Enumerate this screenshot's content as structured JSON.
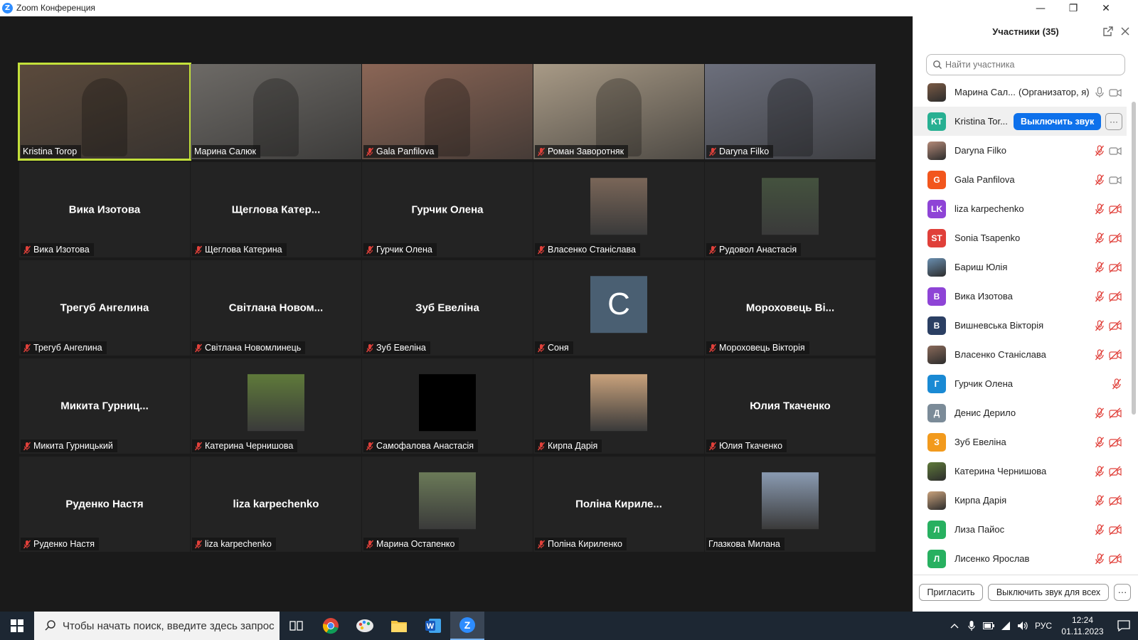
{
  "window": {
    "title": "Zoom Конференция",
    "minimize_glyph": "—",
    "restore_glyph": "❐",
    "close_glyph": "✕"
  },
  "tiles": [
    {
      "name": "Kristina Torop",
      "kind": "video",
      "muted": false,
      "active": true,
      "bg": "#5b4a3c"
    },
    {
      "name": "Марина Салюк",
      "kind": "video",
      "muted": false,
      "bg": "#6d6a66"
    },
    {
      "name": "Gala Panfilova",
      "kind": "video",
      "muted": true,
      "bg": "#8b6656"
    },
    {
      "name": "Роман Заворотняк",
      "kind": "video",
      "muted": true,
      "bg": "#a89a86"
    },
    {
      "name": "Daryna Filko",
      "kind": "video",
      "muted": true,
      "bg": "#6c6f7c"
    },
    {
      "name": "Вика Изотова",
      "kind": "name",
      "center": "Вика Изотова",
      "muted": true
    },
    {
      "name": "Щеглова Катерина",
      "kind": "name",
      "center": "Щеглова Катер...",
      "muted": true
    },
    {
      "name": "Гурчик Олена",
      "kind": "name",
      "center": "Гурчик Олена",
      "muted": true
    },
    {
      "name": "Власенко Станіслава",
      "kind": "photo",
      "muted": true,
      "bg": "#7a6658"
    },
    {
      "name": "Рудовол Анастасія",
      "kind": "photo",
      "muted": true,
      "bg": "#44523e"
    },
    {
      "name": "Трегуб Ангелина",
      "kind": "name",
      "center": "Трегуб Ангелина",
      "muted": true
    },
    {
      "name": "Світлана Новомлинець",
      "kind": "name",
      "center": "Світлана Новом...",
      "muted": true
    },
    {
      "name": "Зуб Евеліна",
      "kind": "name",
      "center": "Зуб Евеліна",
      "muted": true
    },
    {
      "name": "Соня",
      "kind": "letter",
      "letter": "C",
      "muted": true
    },
    {
      "name": "Мороховець Вікторія",
      "kind": "name",
      "center": "Мороховець Ві...",
      "muted": true
    },
    {
      "name": "Микита Гурницький",
      "kind": "name",
      "center": "Микита Гурниц...",
      "muted": true
    },
    {
      "name": "Катерина Чернишова",
      "kind": "photo",
      "muted": true,
      "bg": "#5f7a3a"
    },
    {
      "name": "Самофалова Анастасія",
      "kind": "photo",
      "muted": true,
      "bg": "#000000"
    },
    {
      "name": "Кирпа Дарія",
      "kind": "photo",
      "muted": true,
      "bg": "#c9a27c"
    },
    {
      "name": "Юлия Ткаченко",
      "kind": "name",
      "center": "Юлия Ткаченко",
      "muted": true
    },
    {
      "name": "Руденко Настя",
      "kind": "name",
      "center": "Руденко Настя",
      "muted": true
    },
    {
      "name": "liza karpechenko",
      "kind": "name",
      "center": "liza karpechenko",
      "muted": true
    },
    {
      "name": "Марина Остапенко",
      "kind": "photo",
      "muted": true,
      "bg": "#6b7a58"
    },
    {
      "name": "Поліна Кириленко",
      "kind": "name",
      "center": "Поліна Кириле...",
      "muted": true
    },
    {
      "name": "Глазкова Милана",
      "kind": "photo",
      "muted": false,
      "bg": "#8a9bb2"
    }
  ],
  "panel": {
    "title": "Участники (35)",
    "search_placeholder": "Найти участника",
    "participants": [
      {
        "name": "Марина Сал...",
        "role": "(Организатор, я)",
        "avatar": "photo",
        "color": "#7a5a45",
        "mic": "on",
        "cam": "on"
      },
      {
        "name": "Kristina Tor...",
        "avatar": "KT",
        "color": "#27b092",
        "mute_button": "Выключить звук",
        "more": "···"
      },
      {
        "name": "Daryna Filko",
        "avatar": "photo",
        "color": "#b48a78",
        "mic": "muted",
        "cam": "on"
      },
      {
        "name": "Gala Panfilova",
        "avatar": "G",
        "color": "#f2561d",
        "mic": "muted",
        "cam": "on"
      },
      {
        "name": "liza karpechenko",
        "avatar": "LK",
        "color": "#8e44d6",
        "mic": "muted",
        "cam": "off"
      },
      {
        "name": "Sonia Tsapenko",
        "avatar": "ST",
        "color": "#e0403a",
        "mic": "muted",
        "cam": "off"
      },
      {
        "name": "Бариш Юлія",
        "avatar": "photo",
        "color": "#6a8fb0",
        "mic": "muted",
        "cam": "off"
      },
      {
        "name": "Вика Изотова",
        "avatar": "B",
        "color": "#8e44d6",
        "mic": "muted",
        "cam": "off"
      },
      {
        "name": "Вишневська Вікторія",
        "avatar": "B",
        "color": "#2b3f63",
        "mic": "muted",
        "cam": "off"
      },
      {
        "name": "Власенко Станіслава",
        "avatar": "photo",
        "color": "#8a6a5a",
        "mic": "muted",
        "cam": "off"
      },
      {
        "name": "Гурчик Олена",
        "avatar": "Г",
        "color": "#1a8ad4",
        "mic": "muted",
        "cam": "none"
      },
      {
        "name": "Денис Дерило",
        "avatar": "Д",
        "color": "#7b8b98",
        "mic": "muted",
        "cam": "off"
      },
      {
        "name": "Зуб Евеліна",
        "avatar": "З",
        "color": "#f29a1d",
        "mic": "muted",
        "cam": "off"
      },
      {
        "name": "Катерина Чернишова",
        "avatar": "photo",
        "color": "#5f7a3a",
        "mic": "muted",
        "cam": "off"
      },
      {
        "name": "Кирпа Дарія",
        "avatar": "photo",
        "color": "#c9a27c",
        "mic": "muted",
        "cam": "off"
      },
      {
        "name": "Лиза Пайос",
        "avatar": "Л",
        "color": "#27b060",
        "mic": "muted",
        "cam": "off"
      },
      {
        "name": "Лисенко Ярослав",
        "avatar": "Л",
        "color": "#27b060",
        "mic": "muted",
        "cam": "off"
      }
    ],
    "invite_label": "Пригласить",
    "mute_all_label": "Выключить звук для всех",
    "more_label": "···"
  },
  "taskbar": {
    "search_placeholder": "Чтобы начать поиск, введите здесь запрос",
    "apps": [
      "task-view",
      "chrome",
      "paint",
      "file-explorer",
      "word",
      "zoom"
    ],
    "language": "РУС",
    "time": "12:24",
    "date": "01.11.2023"
  },
  "colors": {
    "active_speaker": "#c3e03a",
    "mute_red": "#e0403a",
    "zoom_blue": "#0e71eb"
  }
}
